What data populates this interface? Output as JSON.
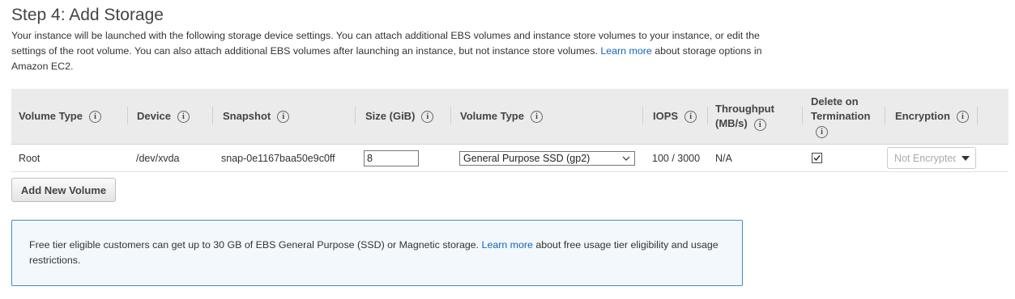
{
  "page": {
    "title": "Step 4: Add Storage",
    "description": "Your instance will be launched with the following storage device settings. You can attach additional EBS volumes and instance store volumes to your instance, or edit the settings of the root volume. You can also attach additional EBS volumes after launching an instance, but not instance store volumes.",
    "learn_more": "Learn more",
    "description_tail": "about storage options in Amazon EC2."
  },
  "table": {
    "headers": {
      "volume_type": "Volume Type",
      "device": "Device",
      "snapshot": "Snapshot",
      "size": "Size (GiB)",
      "ebs_volume_type": "Volume Type",
      "iops": "IOPS",
      "throughput_line1": "Throughput",
      "throughput_line2": "(MB/s)",
      "delete_line1": "Delete on",
      "delete_line2": "Termination",
      "encryption": "Encryption"
    },
    "rows": [
      {
        "volume_type": "Root",
        "device": "/dev/xvda",
        "snapshot": "snap-0e1167baa50e9c0ff",
        "size": "8",
        "ebs_volume_type": "General Purpose SSD (gp2)",
        "iops": "100 / 3000",
        "throughput": "N/A",
        "delete_on_termination": true,
        "encryption": "Not Encrypted"
      }
    ]
  },
  "buttons": {
    "add_volume": "Add New Volume"
  },
  "notice": {
    "text_before": "Free tier eligible customers can get up to 30 GB of EBS General Purpose (SSD) or Magnetic storage.",
    "learn_more": "Learn more",
    "text_after": "about free usage tier eligibility and usage restrictions."
  },
  "icons": {
    "info": "info-icon",
    "checkmark": "checkmark-icon",
    "dropdown": "chevron-down-icon",
    "caret": "caret-down-icon"
  },
  "colors": {
    "link": "#1166bb",
    "notice_border": "#3d8ec8",
    "notice_bg": "#f2f8fc",
    "header_bg": "#ebebeb"
  }
}
